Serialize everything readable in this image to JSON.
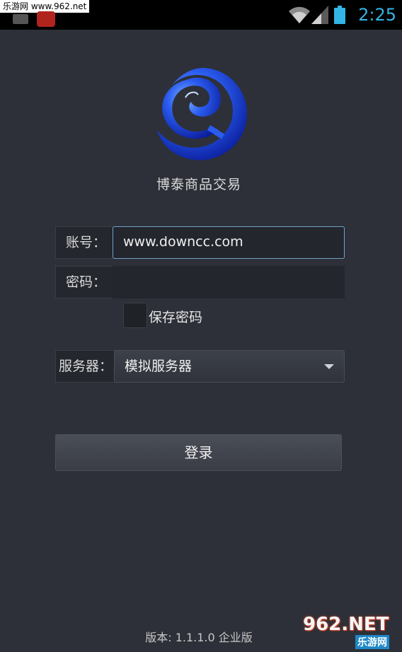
{
  "status_bar": {
    "watermark": "乐游网 www.962.net",
    "time": "2:25",
    "icons": [
      "keyboard-icon",
      "app-notification-icon",
      "wifi-icon",
      "signal-icon",
      "battery-icon"
    ],
    "accent_color": "#33b5e5"
  },
  "app": {
    "title": "博泰商品交易"
  },
  "form": {
    "account_label": "账号：",
    "account_value": "www.downcc.com",
    "password_label": "密码：",
    "password_value": "",
    "save_password_label": "保存密码",
    "save_password_checked": false,
    "server_label": "服务器：",
    "server_value": "模拟服务器",
    "login_label": "登录"
  },
  "footer": {
    "version": "版本: 1.1.1.0  企业版",
    "watermark_big": "962.NET",
    "watermark_small": "乐游网"
  }
}
